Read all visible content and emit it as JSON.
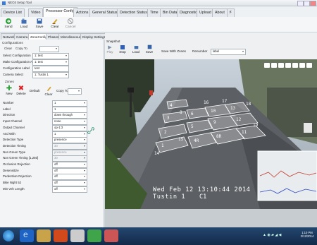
{
  "window": {
    "title": "NEO3 Setup Tool"
  },
  "menu_tabs": [
    {
      "label": "Device List"
    },
    {
      "label": "Video"
    },
    {
      "label": "Processor Config"
    },
    {
      "label": "Actions"
    },
    {
      "label": "General Status"
    },
    {
      "label": "Detection Status"
    },
    {
      "label": "Time"
    },
    {
      "label": "Bin Data"
    },
    {
      "label": "Diagnostic"
    },
    {
      "label": "Upload"
    },
    {
      "label": "About"
    },
    {
      "label": "Ꞙ"
    }
  ],
  "active_menu_tab": "Processor Config",
  "toolbar": [
    {
      "label": "Send",
      "icon": "send-icon"
    },
    {
      "label": "Load",
      "icon": "load-icon"
    },
    {
      "label": "Save",
      "icon": "save-icon"
    },
    {
      "label": "Clear",
      "icon": "clear-icon"
    },
    {
      "label": "Cancel",
      "icon": "cancel-icon"
    }
  ],
  "sub_tabs": [
    {
      "label": "Network"
    },
    {
      "label": "Camera"
    },
    {
      "label": "ZoneConfig"
    },
    {
      "label": "Phases"
    },
    {
      "label": "Miscellaneous"
    },
    {
      "label": "Display Settings"
    },
    {
      "label": "Time of Day"
    }
  ],
  "configurations": {
    "group_title": "Configurations",
    "clear_label": "Clear",
    "copy_to_label": "Copy To",
    "select_configuration_label": "Select Configuration",
    "select_configuration_value": "1: test",
    "make_active_label": "Make Configuration Active",
    "make_active_value": "1: test",
    "config_label_label": "Configuration Label",
    "config_label_value": "test",
    "camera_select_label": "Camera Select",
    "camera_select_value": "1: Tustin 1"
  },
  "zones": {
    "group_title": "Zones",
    "new_label": "New",
    "delete_label": "Delete",
    "default_label": "Default",
    "clear_label": "Clear",
    "copy_to_label": "Copy To"
  },
  "zone_fields": [
    {
      "label": "Number",
      "value": "1"
    },
    {
      "label": "Label",
      "value": "1"
    },
    {
      "label": "Direction",
      "value": "down through"
    },
    {
      "label": "Input Channel",
      "value": "none"
    },
    {
      "label": "Output Channel",
      "value": "op-1:3"
    },
    {
      "label": "And With",
      "value": "1"
    },
    {
      "label": "Detection Type",
      "value": "presence"
    },
    {
      "label": "Detection Timing",
      "value": "30",
      "disabled": true
    },
    {
      "label": "Non Green Type",
      "value": "presence",
      "disabled": true
    },
    {
      "label": "Non Green Timing [1,250]",
      "value": "30",
      "disabled": true
    },
    {
      "label": "Occlusion Rejection",
      "value": "off"
    },
    {
      "label": "Desensitize",
      "value": "off"
    },
    {
      "label": "Pedestrian Rejection",
      "value": "off"
    },
    {
      "label": "Bike Night 52",
      "value": "off"
    },
    {
      "label": "Min Veh Length",
      "value": "off"
    }
  ],
  "snapshot": {
    "group_title": "Snapshot",
    "buttons": [
      {
        "label": "Play"
      },
      {
        "label": "Stop"
      },
      {
        "label": "Load"
      },
      {
        "label": "Save"
      }
    ],
    "save_with_zones_label": "Save With Zones",
    "renumber_label": "Renumber",
    "renumber_value": "label"
  },
  "camera": {
    "timestamp": "Wed Feb 12 13:10:44 2014",
    "camera_name": "Tustin 1",
    "camera_id": "C1",
    "zone_labels": [
      "1",
      "2",
      "3",
      "4",
      "4R",
      "5",
      "6",
      "8R",
      "9",
      "10",
      "11",
      "12",
      "13",
      "14",
      "15",
      "16",
      "17",
      "18",
      "19",
      "8"
    ]
  },
  "tray": {
    "time": "1:10 PM",
    "date": "2/12/2014"
  },
  "colors": {
    "menu_active": "#fdfdfd",
    "taskbar": "#13294a",
    "zone_outline": "#ffffff",
    "road": "#5c5f63"
  }
}
